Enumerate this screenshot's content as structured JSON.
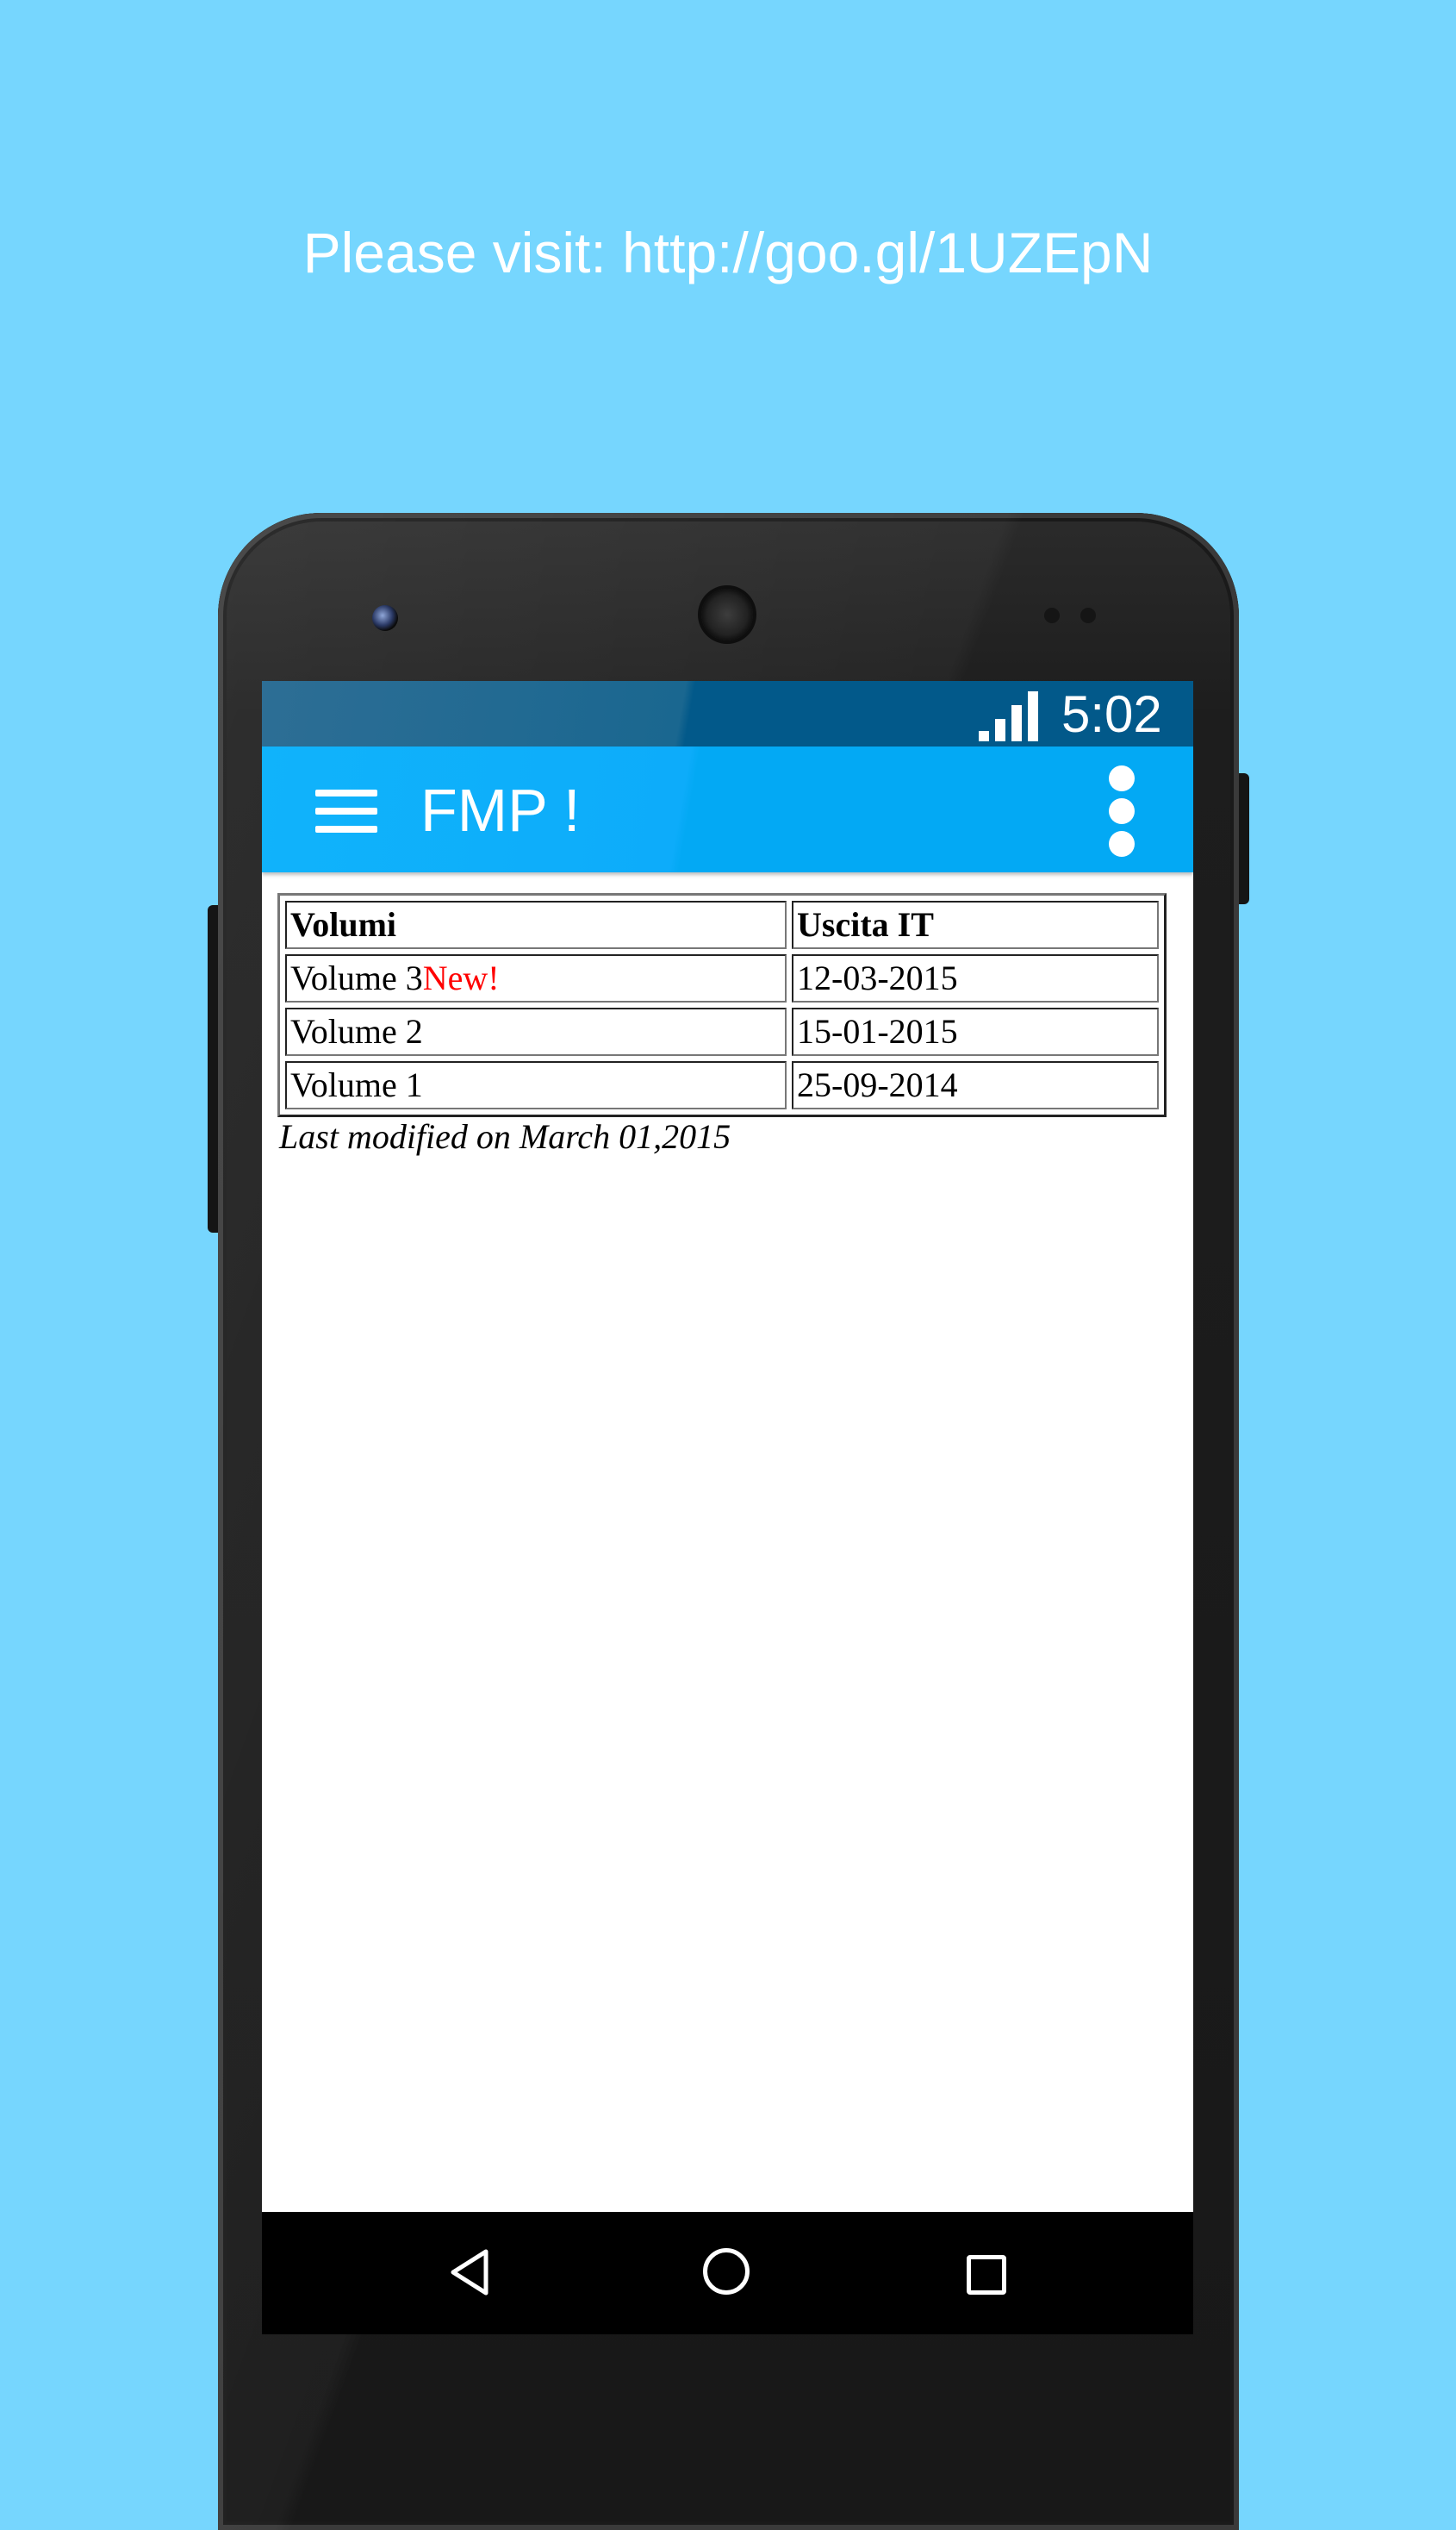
{
  "promo_text": "Please visit: http://goo.gl/1UZEpN",
  "status_bar": {
    "time": "5:02",
    "signal_icon": "cell-signal-icon"
  },
  "app_bar": {
    "menu_icon": "hamburger-menu-icon",
    "title": "FMP !",
    "overflow_icon": "more-vert-icon",
    "colors": {
      "status_bar": "#02598a",
      "app_bar": "#03a9f4"
    }
  },
  "table": {
    "headers": [
      "Volumi",
      "Uscita IT"
    ],
    "rows": [
      {
        "volume": "Volume 3",
        "badge": "New!",
        "date": "12-03-2015"
      },
      {
        "volume": "Volume 2",
        "badge": "",
        "date": "15-01-2015"
      },
      {
        "volume": "Volume 1",
        "badge": "",
        "date": "25-09-2014"
      }
    ],
    "badge_color": "#ff0000"
  },
  "last_modified": "Last modified on March 01,2015",
  "nav_bar": {
    "back_icon": "back-triangle-icon",
    "home_icon": "home-circle-icon",
    "recents_icon": "recents-square-icon"
  },
  "background_color": "#76d6fe"
}
